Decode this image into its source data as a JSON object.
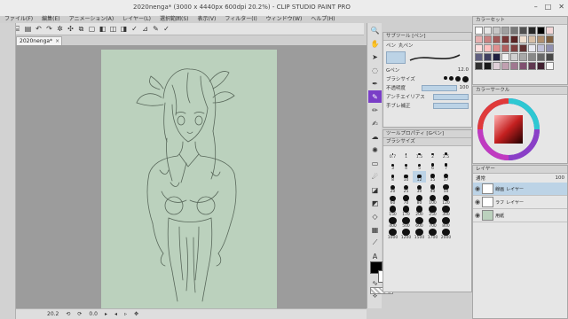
{
  "app": {
    "title": "2020nenga* (3000 x 4440px 600dpi 20.2%) - CLIP STUDIO PAINT PRO",
    "window_controls": [
      "–",
      "□",
      "✕"
    ]
  },
  "menu": [
    "ファイル(F)",
    "編集(E)",
    "アニメーション(A)",
    "レイヤー(L)",
    "選択範囲(S)",
    "表示(V)",
    "フィルター(I)",
    "ウィンドウ(W)",
    "ヘルプ(H)"
  ],
  "document_tab": {
    "label": "2020nenga*",
    "close": "×"
  },
  "status": {
    "zoom": "20.2",
    "rotate": "0.0",
    "items": [
      "⟲",
      "⟳",
      "▸",
      "◂",
      "▹",
      "✥"
    ]
  },
  "subtool": {
    "header": "サブツール [ペン]",
    "selected_name": "Gペン",
    "sizes_label": "ブラシサイズ",
    "pen_name": "丸ペン",
    "pen_entry": "ペン",
    "size_value": "12.0",
    "rows": [
      {
        "label": "不透明度",
        "value": "100"
      },
      {
        "label": "アンチエイリアス",
        "value": ""
      },
      {
        "label": "手ブレ補正",
        "value": ""
      }
    ]
  },
  "tool_property": {
    "header": "ツールプロパティ [Gペン]"
  },
  "brush_size": {
    "header": "ブラシサイズ",
    "sizes": [
      "0.7",
      "1",
      "1.5",
      "2",
      "2.5",
      "3",
      "4",
      "5",
      "6",
      "7",
      "8",
      "10",
      "12",
      "15",
      "17",
      "20",
      "25",
      "30",
      "40",
      "50",
      "60",
      "70",
      "80",
      "100",
      "120",
      "150",
      "170",
      "200",
      "250",
      "300",
      "400",
      "500",
      "600",
      "700",
      "800",
      "1000",
      "1200",
      "1500",
      "1700",
      "2000"
    ],
    "selected": "12"
  },
  "color_set": {
    "header": "カラーセット"
  },
  "color_wheel": {
    "header": "カラーサークル",
    "accent": "#7a3ec7"
  },
  "layers": {
    "header": "レイヤー",
    "blend_mode": "通常",
    "opacity": "100",
    "items": [
      {
        "name": "線画",
        "sub": "レイヤー",
        "selected": true
      },
      {
        "name": "ラフ",
        "sub": "レイヤー",
        "selected": false
      },
      {
        "name": "用紙",
        "sub": "",
        "selected": false
      }
    ]
  },
  "colors": {
    "main": "#000000",
    "sub": "#ffffff",
    "paper": "#bbd1bd",
    "canvas_bg": "#9c9c9c",
    "selection": "#bcd3e6"
  }
}
